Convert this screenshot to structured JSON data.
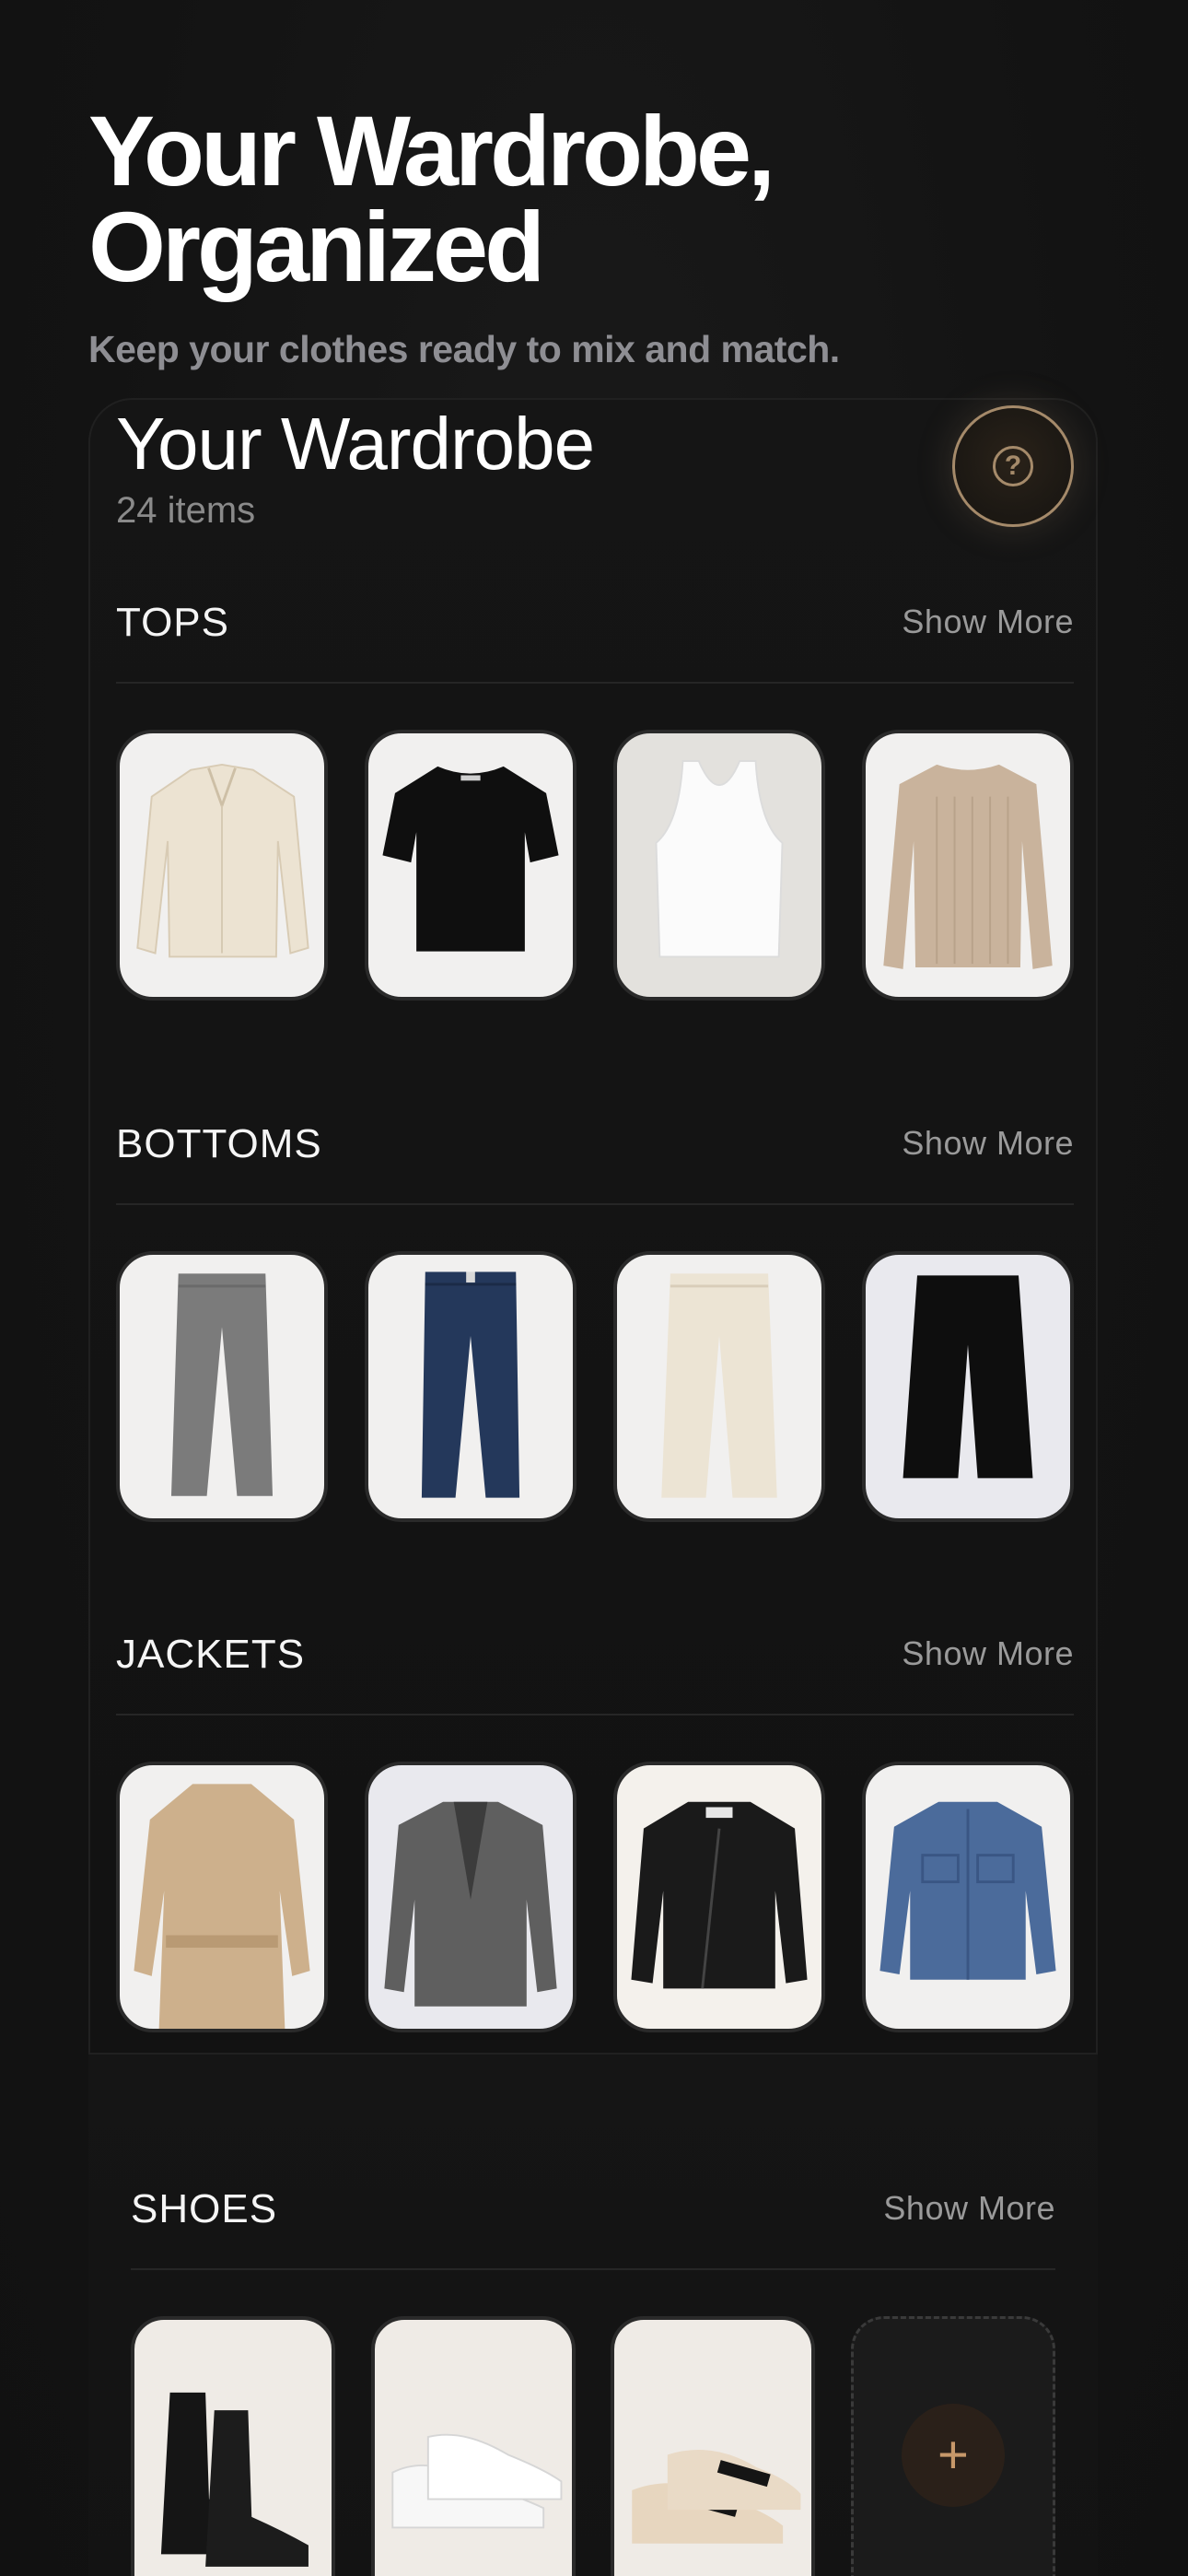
{
  "hero": {
    "title": "Your Wardrobe, Organized",
    "subtitle": "Keep your clothes ready to mix and match."
  },
  "wardrobe": {
    "title": "Your Wardrobe",
    "count": "24 items",
    "help_icon": "question-circle-icon"
  },
  "sections": [
    {
      "label": "TOPS",
      "show_more": "Show More",
      "items": [
        "cream silk blouse",
        "black short-sleeve tee",
        "white tank top",
        "beige ribbed sweater"
      ]
    },
    {
      "label": "BOTTOMS",
      "show_more": "Show More",
      "items": [
        "grey tailored trousers",
        "dark blue jeans",
        "cream pleated trousers",
        "black wide-leg culottes"
      ]
    },
    {
      "label": "JACKETS",
      "show_more": "Show More",
      "items": [
        "beige trench coat",
        "grey blazer",
        "black leather jacket",
        "blue denim jacket"
      ]
    },
    {
      "label": "SHOES",
      "show_more": "Show More",
      "items": [
        "black chelsea boots",
        "white sneakers",
        "beige penny loafers"
      ],
      "add_icon": "plus-icon"
    }
  ],
  "colors": {
    "background": "#141414",
    "accent": "#a58a6a",
    "muted_text": "#8e8e93"
  }
}
